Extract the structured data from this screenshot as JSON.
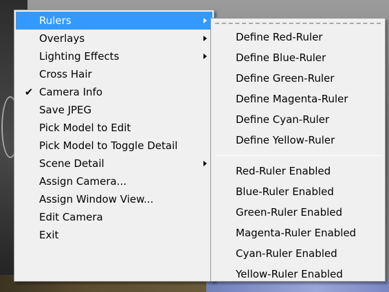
{
  "main_menu": {
    "items": [
      {
        "label": "Rulers",
        "submenu": true,
        "highlighted": true,
        "checked": false
      },
      {
        "label": "Overlays",
        "submenu": true,
        "highlighted": false,
        "checked": false
      },
      {
        "label": "Lighting Effects",
        "submenu": true,
        "highlighted": false,
        "checked": false
      },
      {
        "label": "Cross Hair",
        "submenu": false,
        "highlighted": false,
        "checked": false
      },
      {
        "label": "Camera Info",
        "submenu": false,
        "highlighted": false,
        "checked": true
      },
      {
        "label": "Save JPEG",
        "submenu": false,
        "highlighted": false,
        "checked": false
      },
      {
        "label": "Pick Model to Edit",
        "submenu": false,
        "highlighted": false,
        "checked": false
      },
      {
        "label": "Pick Model to Toggle Detail",
        "submenu": false,
        "highlighted": false,
        "checked": false
      },
      {
        "label": "Scene Detail",
        "submenu": true,
        "highlighted": false,
        "checked": false
      },
      {
        "label": "Assign Camera...",
        "submenu": false,
        "highlighted": false,
        "checked": false
      },
      {
        "label": "Assign Window View...",
        "submenu": false,
        "highlighted": false,
        "checked": false
      },
      {
        "label": "Edit Camera",
        "submenu": false,
        "highlighted": false,
        "checked": false
      },
      {
        "label": "Exit",
        "submenu": false,
        "highlighted": false,
        "checked": false
      }
    ],
    "check_glyph": "✔"
  },
  "rulers_submenu": {
    "define_items": [
      {
        "label": "Define Red-Ruler"
      },
      {
        "label": "Define Blue-Ruler"
      },
      {
        "label": "Define Green-Ruler"
      },
      {
        "label": "Define Magenta-Ruler"
      },
      {
        "label": "Define Cyan-Ruler"
      },
      {
        "label": "Define Yellow-Ruler"
      }
    ],
    "enable_items": [
      {
        "label": "Red-Ruler Enabled"
      },
      {
        "label": "Blue-Ruler Enabled"
      },
      {
        "label": "Green-Ruler Enabled"
      },
      {
        "label": "Magenta-Ruler Enabled"
      },
      {
        "label": "Cyan-Ruler Enabled"
      },
      {
        "label": "Yellow-Ruler Enabled"
      }
    ]
  },
  "colors": {
    "menu_bg": "#f0f0f0",
    "highlight": "#3399ff",
    "highlight_text": "#ffffff"
  }
}
